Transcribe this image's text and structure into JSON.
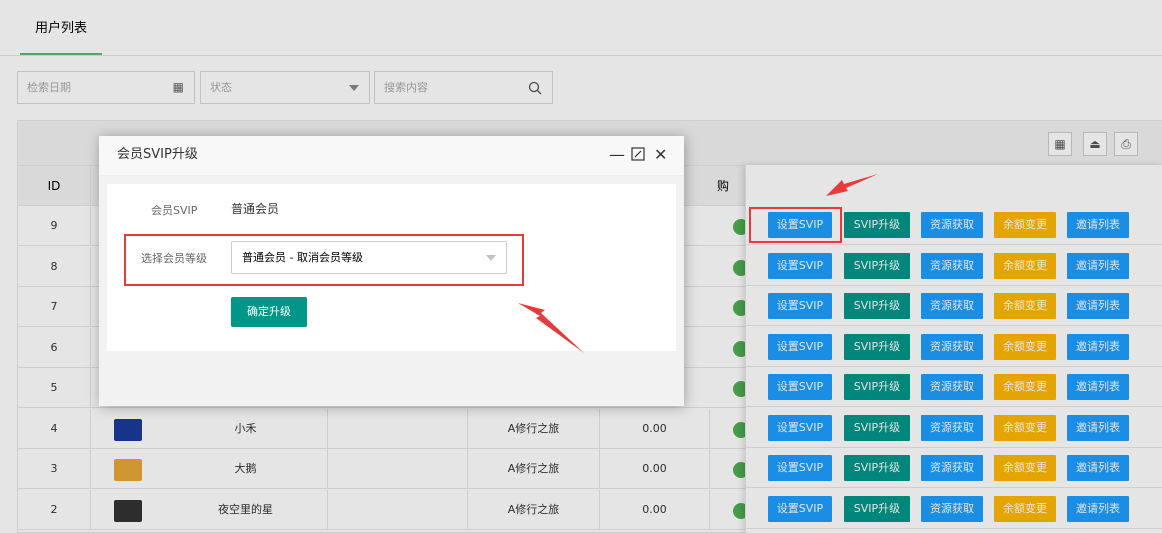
{
  "tab": {
    "title": "用户列表"
  },
  "filters": {
    "date_placeholder": "检索日期",
    "status_placeholder": "状态",
    "search_placeholder": "搜索内容"
  },
  "table": {
    "header_id": "ID",
    "header_partial": "购",
    "rows": [
      {
        "id": "9"
      },
      {
        "id": "8"
      },
      {
        "id": "7"
      },
      {
        "id": "6"
      },
      {
        "id": "5"
      },
      {
        "id": "4",
        "name": "小禾",
        "group": "A修行之旅",
        "amount": "0.00"
      },
      {
        "id": "3",
        "name": "大鹅",
        "group": "A修行之旅",
        "amount": "0.00"
      },
      {
        "id": "2",
        "name": "夜空里的星",
        "group": "A修行之旅",
        "amount": "0.00"
      }
    ]
  },
  "actions": {
    "set_svip": "设置SVIP",
    "svip_upgrade": "SVIP升级",
    "resource": "资源获取",
    "balance": "余额变更",
    "invite": "邀请列表"
  },
  "colors": {
    "blue": "#1e9fff",
    "teal": "#009688",
    "orange": "#ffb800",
    "green_toggle": "#4caf50",
    "highlight_red": "#e8393b"
  },
  "dialog": {
    "title": "会员SVIP升级",
    "current_label": "会员SVIP",
    "current_value": "普通会员",
    "level_label": "选择会员等级",
    "level_selected": "普通会员 - 取消会员等级",
    "confirm": "确定升级"
  }
}
